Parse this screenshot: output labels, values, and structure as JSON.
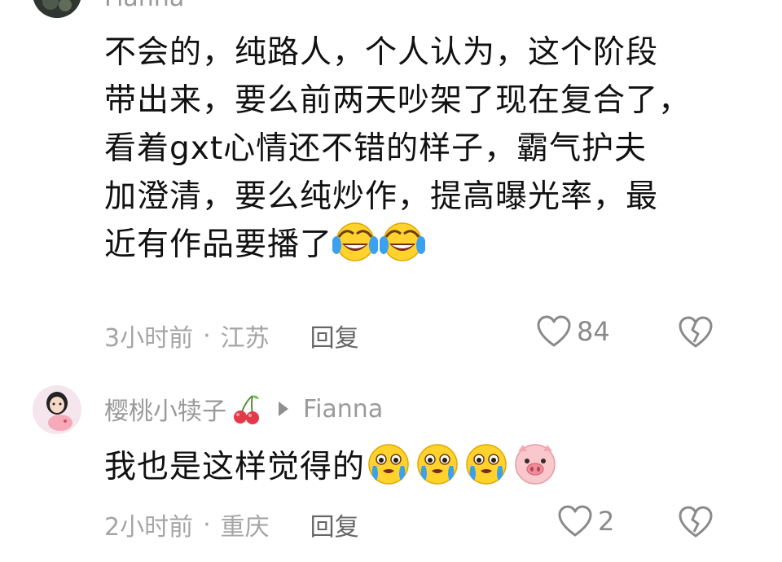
{
  "comments": [
    {
      "username": "Fianna",
      "lines": [
        "不会的，纯路人，个人认为，这个阶段",
        "带出来，要么前两天吵架了现在复合了，",
        "看着gxt心情还不错的样子，霸气护夫",
        "加澄清，要么纯炒作，提高曝光率，最",
        "近有作品要播了"
      ],
      "emojis": [
        "laugh-cry-emoji",
        "laugh-cry-emoji"
      ],
      "time": "3小时前",
      "separator": "·",
      "location": "江苏",
      "reply_label": "回复",
      "likes": "84"
    },
    {
      "username": "樱桃小犊子",
      "reply_to": "Fianna",
      "text": "我也是这样觉得的",
      "emojis": [
        "teary-emoji",
        "teary-emoji",
        "teary-emoji",
        "pig-face-emoji"
      ],
      "time": "2小时前",
      "separator": "·",
      "location": "重庆",
      "reply_label": "回复",
      "likes": "2"
    }
  ],
  "colors": {
    "text": "#111111",
    "meta": "#a5a5a5",
    "username": "#9a9a9a",
    "icon": "#8a8a8a"
  }
}
